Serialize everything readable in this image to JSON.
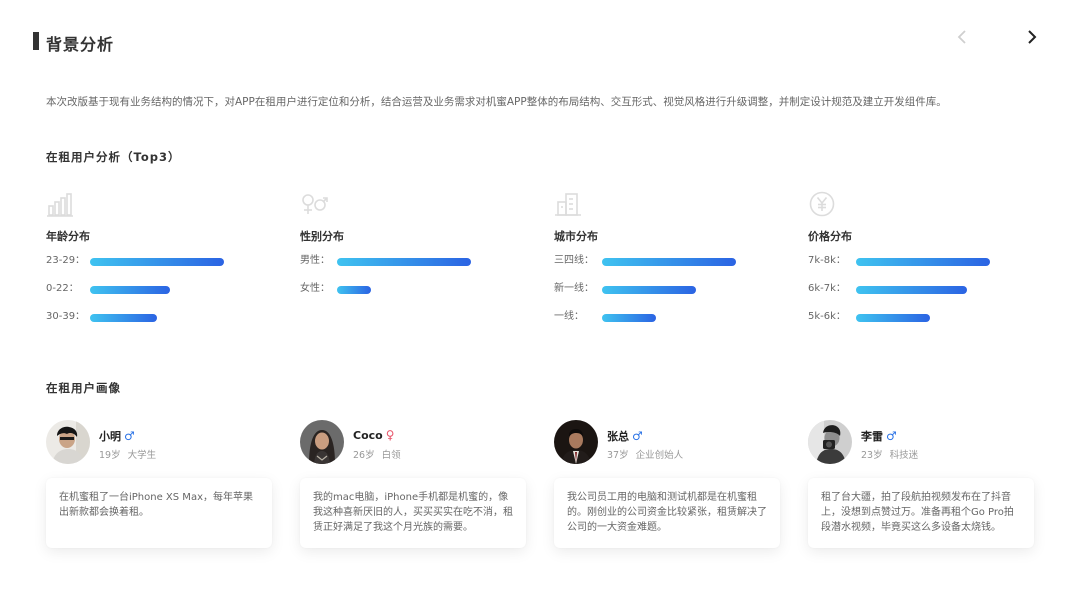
{
  "header": {
    "title": "背景分析",
    "prev_icon": "chevron-left-icon",
    "next_icon": "chevron-right-icon"
  },
  "intro": "本次改版基于现有业务结构的情况下，对APP在租用户进行定位和分析，结合运营及业务需求对机蜜APP整体的布局结构、交互形式、视觉风格进行升级调整，并制定设计规范及建立开发组件库。",
  "analysis": {
    "title": "在租用户分析（Top3）",
    "bar_gradient": [
      "#3fc3f0",
      "#2b63e3"
    ],
    "groups": [
      {
        "heading": "年龄分布",
        "icon": "bar-chart-icon",
        "rows": [
          {
            "label": "23-29：",
            "value": 1.0
          },
          {
            "label": "0-22：",
            "value": 0.6
          },
          {
            "label": "30-39：",
            "value": 0.5
          }
        ]
      },
      {
        "heading": "性别分布",
        "icon": "gender-icon",
        "rows": [
          {
            "label": "男性：",
            "value": 1.0
          },
          {
            "label": "女性：",
            "value": 0.25
          }
        ]
      },
      {
        "heading": "城市分布",
        "icon": "building-icon",
        "rows": [
          {
            "label": "三四线：",
            "value": 1.0
          },
          {
            "label": "新一线：",
            "value": 0.7
          },
          {
            "label": "一线：",
            "value": 0.4
          }
        ]
      },
      {
        "heading": "价格分布",
        "icon": "yen-coin-icon",
        "rows": [
          {
            "label": "7k-8k：",
            "value": 1.0
          },
          {
            "label": "6k-7k：",
            "value": 0.83
          },
          {
            "label": "5k-6k：",
            "value": 0.55
          }
        ]
      }
    ]
  },
  "personas": {
    "title": "在租用户画像",
    "male_color": "#2b73e6",
    "female_color": "#e8566b",
    "items": [
      {
        "name": "小明",
        "sex": "♂",
        "age": "19岁",
        "tag": "大学生",
        "quote": "在机蜜租了一台iPhone XS Max，每年苹果出新款都会换着租。"
      },
      {
        "name": "Coco",
        "sex": "♀",
        "age": "26岁",
        "tag": "白领",
        "quote": "我的mac电脑，iPhone手机都是机蜜的，像我这种喜新厌旧的人，买买买实在吃不消，租赁正好满足了我这个月光族的需要。"
      },
      {
        "name": "张总",
        "sex": "♂",
        "age": "37岁",
        "tag": "企业创始人",
        "quote": "我公司员工用的电脑和测试机都是在机蜜租的。刚创业的公司资金比较紧张，租赁解决了公司的一大资金难题。"
      },
      {
        "name": "李雷",
        "sex": "♂",
        "age": "23岁",
        "tag": "科技迷",
        "quote": "租了台大疆，拍了段航拍视频发布在了抖音上，没想到点赞过万。准备再租个Go Pro拍段潜水视频，毕竟买这么多设备太烧钱。"
      }
    ]
  }
}
